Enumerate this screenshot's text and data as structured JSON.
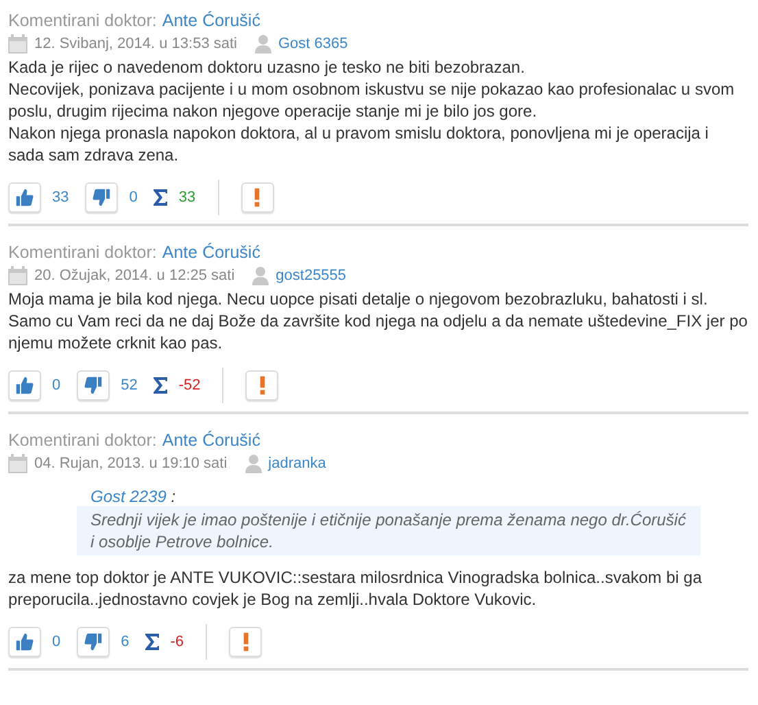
{
  "comments": [
    {
      "doctor_label": "Komentirani doktor:",
      "doctor": "Ante Ćorušić",
      "date": "12. Svibanj, 2014. u 13:53 sati",
      "author": "Gost 6365",
      "paragraphs": [
        "Kada je rijec o navedenom doktoru uzasno je tesko ne biti bezobrazan.",
        "Necovijek, ponizava pacijente i u mom osobnom iskustvu se nije pokazao kao profesionalac u svom poslu, drugim rijecima nakon njegove operacije stanje mi je bilo jos gore.",
        "Nakon njega pronasla napokon doktora, al u pravom smislu doktora, ponovljena mi je operacija i sada sam zdrava zena."
      ],
      "likes": "33",
      "dislikes": "0",
      "total": "33",
      "color": "#2c9a2c"
    },
    {
      "doctor_label": "Komentirani doktor:",
      "doctor": "Ante Ćorušić",
      "date": "20. Ožujak, 2014. u 12:25 sati",
      "author": "gost25555",
      "paragraphs": [
        "Moja mama je bila kod njega. Necu uopce pisati detalje o njegovom bezobrazluku, bahatosti i sl. Samo cu Vam reci da ne daj Bože da završite kod njega na odjelu a da nemate uštedevine_FIX jer po njemu možete crknit kao pas."
      ],
      "likes": "0",
      "dislikes": "52",
      "total": "-52",
      "color": "#d52020"
    },
    {
      "doctor_label": "Komentirani doktor:",
      "doctor": "Ante Ćorušić",
      "date": "04. Rujan, 2013. u 19:10 sati",
      "author": "jadranka",
      "quote": {
        "author": "Gost 2239",
        "separator": ":",
        "text": "Srednji vijek je imao poštenije i etičnije ponašanje prema ženama nego dr.Ćorušić i osoblje Petrove bolnice."
      },
      "paragraphs": [
        "za mene top doktor je ANTE VUKOVIC::sestara milosrdnica Vinogradska bolnica..svakom bi ga preporucila..jednostavno covjek je Bog na zemlji..hvala Doktore Vukovic."
      ],
      "likes": "0",
      "dislikes": "6",
      "total": "-6",
      "color": "#d52020"
    }
  ]
}
